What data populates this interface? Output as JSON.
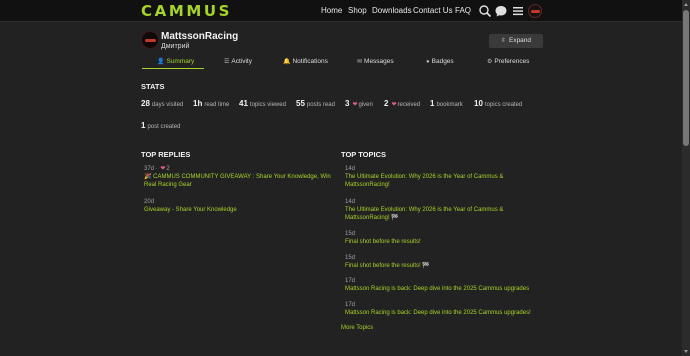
{
  "header": {
    "logo": "CAMMUS",
    "nav": [
      "Home",
      "Shop",
      "Downloads",
      "Contact Us",
      "FAQ"
    ]
  },
  "profile": {
    "username": "MattssonRacing",
    "name": "Дмитрий",
    "expand_label": "Expand"
  },
  "tabs": [
    "Summary",
    "Activity",
    "Notifications",
    "Messages",
    "Badges",
    "Preferences"
  ],
  "stats": {
    "title": "STATS",
    "items": [
      {
        "value": "28",
        "label": "days visited"
      },
      {
        "value": "1h",
        "label": "read time"
      },
      {
        "value": "41",
        "label": "topics viewed"
      },
      {
        "value": "55",
        "label": "posts read"
      },
      {
        "value": "3",
        "label": "given"
      },
      {
        "value": "2",
        "label": "received"
      },
      {
        "value": "1",
        "label": "bookmark"
      },
      {
        "value": "10",
        "label": "topics created"
      },
      {
        "value": "1",
        "label": "post created"
      }
    ]
  },
  "top_replies": {
    "title": "TOP REPLIES",
    "items": [
      {
        "age": "37d",
        "likes": "2",
        "title": "🎉 CAMMUS COMMUNITY GIVEAWAY : Share Your Knowledge, Win Real Racing Gear"
      },
      {
        "age": "20d",
        "title": "Giveaway - Share Your Knowledge"
      }
    ]
  },
  "top_topics": {
    "title": "TOP TOPICS",
    "items": [
      {
        "age": "14d",
        "title": "The Ultimate Evolution: Why 2026 is the Year of Cammus & MattssonRacing!"
      },
      {
        "age": "14d",
        "title": "The Ultimate Evolution: Why 2026 is the Year of Cammus & MattssonRacing! 🏁"
      },
      {
        "age": "15d",
        "title": "Final shot before the results!"
      },
      {
        "age": "15d",
        "title": "Final shot before the results! 🏁"
      },
      {
        "age": "17d",
        "title": "Mattsson Racing is back: Deep dive into the 2025 Cammus upgrades"
      },
      {
        "age": "17d",
        "title": "Mattsson Racing is back: Deep dive into the 2025 Cammus upgrades!"
      }
    ],
    "more": "More Topics"
  },
  "colors": {
    "accent": "#a6d32a",
    "background": "#222222",
    "header": "#111111",
    "heart": "#e35a8a"
  },
  "icons": [
    "search-icon",
    "chat-icon",
    "hamburger-menu-icon",
    "user-avatar"
  ]
}
